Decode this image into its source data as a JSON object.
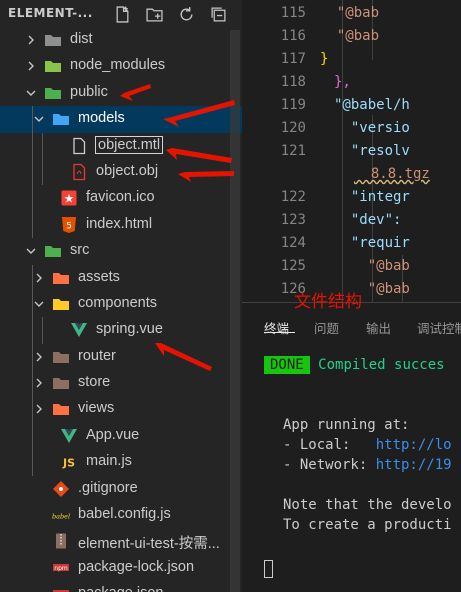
{
  "explorer": {
    "title": "ELEMENT-...",
    "actions": [
      "new-file-icon",
      "new-folder-icon",
      "refresh-icon",
      "collapse-all-icon"
    ],
    "items": [
      {
        "label": "dist",
        "type": "folder",
        "depth": 1,
        "expanded": false,
        "icon": "folder-icon",
        "color": "#8f8f8f"
      },
      {
        "label": "node_modules",
        "type": "folder",
        "depth": 1,
        "expanded": false,
        "icon": "node-modules-folder-icon",
        "color": "#8bc34a"
      },
      {
        "label": "public",
        "type": "folder",
        "depth": 1,
        "expanded": true,
        "icon": "public-folder-icon",
        "color": "#4caf50"
      },
      {
        "label": "models",
        "type": "folder",
        "depth": 2,
        "expanded": true,
        "icon": "models-folder-icon",
        "color": "#42a5f5",
        "selected": true
      },
      {
        "label": "object.mtl",
        "type": "file",
        "depth": 3,
        "icon": "file-icon",
        "color": "#cccccc",
        "outlined": true
      },
      {
        "label": "object.obj",
        "type": "file",
        "depth": 3,
        "icon": "pdf-file-icon",
        "color": "#e53935"
      },
      {
        "label": "favicon.ico",
        "type": "file",
        "depth": 2,
        "icon": "favicon-icon",
        "color": "#f44336"
      },
      {
        "label": "index.html",
        "type": "file",
        "depth": 2,
        "icon": "html-icon",
        "color": "#e65100"
      },
      {
        "label": "src",
        "type": "folder",
        "depth": 1,
        "expanded": true,
        "icon": "src-folder-icon",
        "color": "#4caf50"
      },
      {
        "label": "assets",
        "type": "folder",
        "depth": 2,
        "expanded": false,
        "icon": "assets-folder-icon",
        "color": "#ff7043"
      },
      {
        "label": "components",
        "type": "folder",
        "depth": 2,
        "expanded": true,
        "icon": "components-folder-icon",
        "color": "#ffca28"
      },
      {
        "label": "spring.vue",
        "type": "file",
        "depth": 3,
        "icon": "vue-icon",
        "color": "#41b883"
      },
      {
        "label": "router",
        "type": "folder",
        "depth": 2,
        "expanded": false,
        "icon": "router-folder-icon",
        "color": "#8d6e63"
      },
      {
        "label": "store",
        "type": "folder",
        "depth": 2,
        "expanded": false,
        "icon": "store-folder-icon",
        "color": "#8d6e63"
      },
      {
        "label": "views",
        "type": "folder",
        "depth": 2,
        "expanded": false,
        "icon": "views-folder-icon",
        "color": "#ff7043"
      },
      {
        "label": "App.vue",
        "type": "file",
        "depth": 2,
        "icon": "vue-icon",
        "color": "#41b883"
      },
      {
        "label": "main.js",
        "type": "file",
        "depth": 2,
        "icon": "js-icon",
        "color": "#fbc02d"
      },
      {
        "label": ".gitignore",
        "type": "file",
        "depth": 1,
        "icon": "git-icon",
        "color": "#e64a19"
      },
      {
        "label": "babel.config.js",
        "type": "file",
        "depth": 1,
        "icon": "babel-icon",
        "color": "#f9dc3e"
      },
      {
        "label": "element-ui-test-按需...",
        "type": "file",
        "depth": 1,
        "icon": "archive-icon",
        "color": "#8d6e63"
      },
      {
        "label": "package-lock.json",
        "type": "file",
        "depth": 1,
        "icon": "npm-icon",
        "color": "#cb3837"
      },
      {
        "label": "package.json",
        "type": "file",
        "depth": 1,
        "icon": "npm-icon",
        "color": "#cb3837"
      }
    ]
  },
  "editor": {
    "lines": [
      {
        "num": "115",
        "text": "  \"@bab"
      },
      {
        "num": "116",
        "text": "  \"@bab"
      },
      {
        "num": "117",
        "text": "}"
      },
      {
        "num": "118",
        "text": "},"
      },
      {
        "num": "119",
        "text": "\"@babel/h"
      },
      {
        "num": "120",
        "text": "  \"versio"
      },
      {
        "num": "121",
        "text": "  \"resolv"
      },
      {
        "num": "",
        "text": "  8.8.tgz"
      },
      {
        "num": "122",
        "text": "  \"integr"
      },
      {
        "num": "123",
        "text": "  \"dev\":"
      },
      {
        "num": "124",
        "text": "  \"requir"
      },
      {
        "num": "125",
        "text": "    \"@bab"
      },
      {
        "num": "126",
        "text": "    \"@bab"
      }
    ]
  },
  "panel": {
    "tabs": [
      "终端",
      "问题",
      "输出",
      "调试控制"
    ],
    "active_tab": "终端"
  },
  "terminal": {
    "done_badge": "DONE",
    "compiled": "Compiled succes",
    "app_running": "App running at:",
    "local_label": "- Local:   ",
    "local_url": "http://lo",
    "network_label": "- Network: ",
    "network_url": "http://19",
    "note1": "Note that the develo",
    "note2": "To create a producti"
  },
  "annotation": {
    "text": "文件结构",
    "color": "#e51400"
  }
}
